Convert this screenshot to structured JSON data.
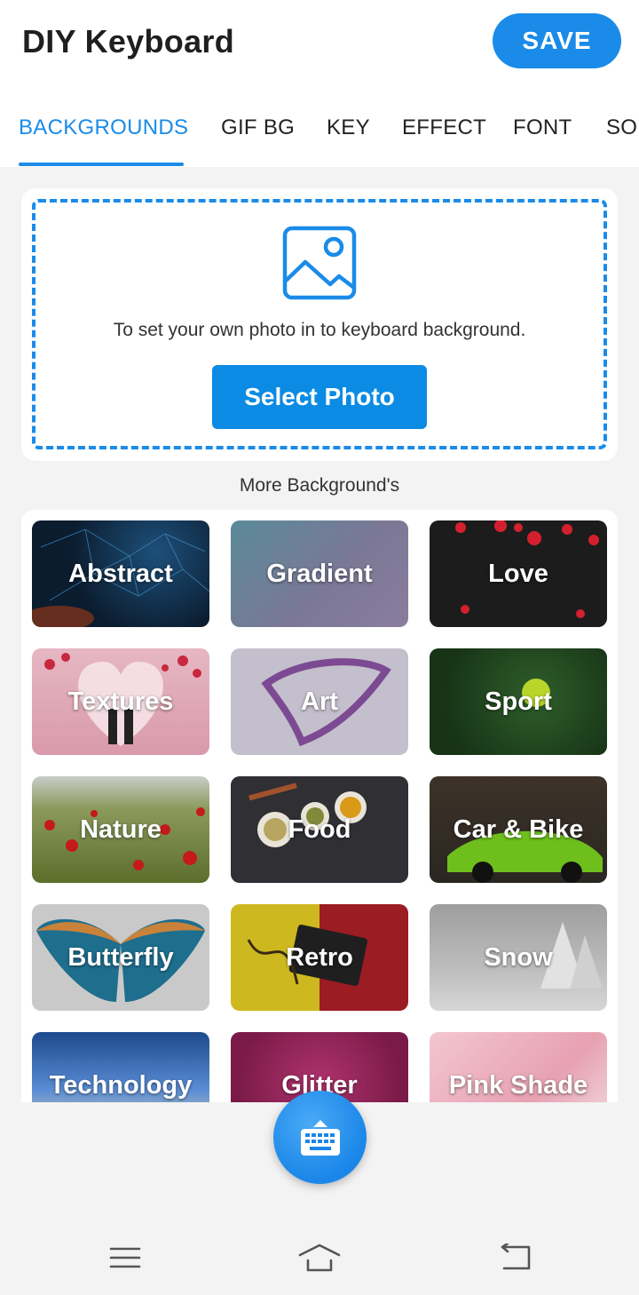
{
  "header": {
    "title": "DIY Keyboard",
    "save_label": "SAVE"
  },
  "tabs": [
    {
      "label": "BACKGROUNDS",
      "active": true
    },
    {
      "label": "GIF BG"
    },
    {
      "label": "KEY"
    },
    {
      "label": "EFFECT"
    },
    {
      "label": "FONT"
    },
    {
      "label": "SOUND"
    }
  ],
  "upload": {
    "icon": "image-icon",
    "text": "To set your own photo in to keyboard background.",
    "button_label": "Select Photo"
  },
  "more_label": "More Background's",
  "categories": [
    {
      "label": "Abstract"
    },
    {
      "label": "Gradient"
    },
    {
      "label": "Love"
    },
    {
      "label": "Textures"
    },
    {
      "label": "Art"
    },
    {
      "label": "Sport"
    },
    {
      "label": "Nature"
    },
    {
      "label": "Food"
    },
    {
      "label": "Car & Bike"
    },
    {
      "label": "Butterfly"
    },
    {
      "label": "Retro"
    },
    {
      "label": "Snow"
    },
    {
      "label": "Technology"
    },
    {
      "label": "Glitter"
    },
    {
      "label": "Pink Shade"
    }
  ],
  "fab": {
    "icon": "keyboard-icon"
  },
  "navbar": {
    "menu_icon": "menu-icon",
    "home_icon": "home-icon",
    "back_icon": "back-icon"
  },
  "colors": {
    "accent": "#1a8be8",
    "background": "#f3f3f3"
  }
}
